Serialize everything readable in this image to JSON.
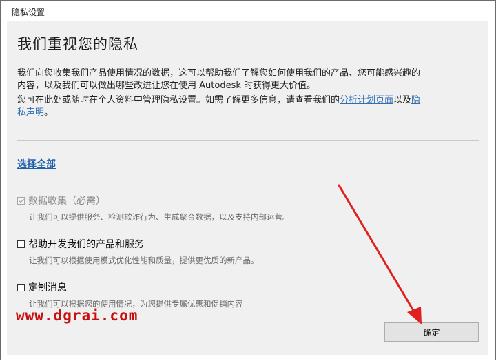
{
  "window": {
    "title": "隐私设置"
  },
  "main": {
    "heading": "我们重视您的隐私",
    "paragraph1_line1": "我们向您收集我们产品使用情况的数据，这可以帮助我们了解您如何使用我们的产品、您可能感兴趣的",
    "paragraph1_line2": "内容，以及我们可以做出哪些改进让您在使用 Autodesk 时获得更大价值。",
    "paragraph2_prefix": "您可在此处或随时在个人资料中管理隐私设置。如需了解更多信息，请查看我们的",
    "paragraph2_link1": "分析计划页面",
    "paragraph2_mid": "以及",
    "paragraph2_link2_line1": "隐",
    "paragraph2_link2_line2": "私声明",
    "paragraph2_suffix": "。",
    "select_all": "选择全部"
  },
  "options": [
    {
      "label": "数据收集（必需）",
      "desc": "让我们可以提供服务、检测欺诈行为、生成聚合数据，以及支持内部运营。",
      "checked": true,
      "disabled": true
    },
    {
      "label": "帮助开发我们的产品和服务",
      "desc": "让我们可以根据使用模式优化性能和质量，提供更优质的新产品。",
      "checked": false,
      "disabled": false
    },
    {
      "label": "定制消息",
      "desc": "让我们可以根据您的使用情况，为您提供专属优惠和促销内容",
      "checked": false,
      "disabled": false
    }
  ],
  "footer": {
    "ok_label": "确定"
  },
  "watermark": "www.dgrai.com",
  "colors": {
    "arrow": "#e02020",
    "link": "#2f6fb4",
    "watermark": "#c81010"
  }
}
